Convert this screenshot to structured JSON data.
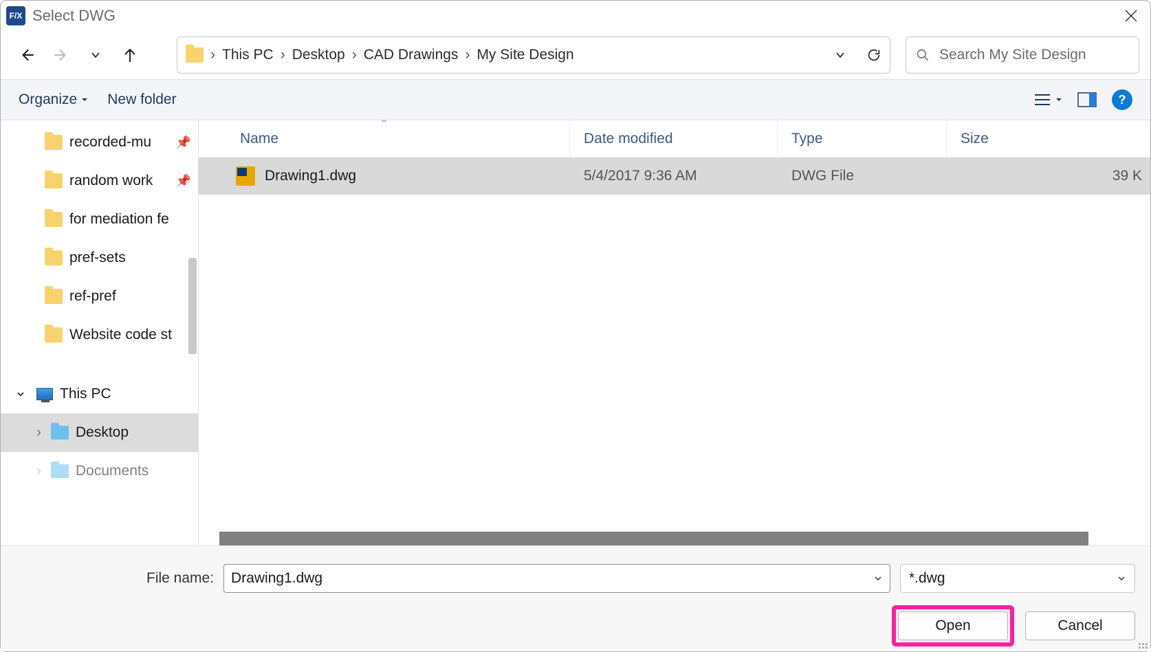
{
  "title": "Select DWG",
  "breadcrumbs": [
    "This PC",
    "Desktop",
    "CAD Drawings",
    "My Site Design"
  ],
  "search": {
    "placeholder": "Search My Site Design"
  },
  "toolbar": {
    "organize": "Organize",
    "newfolder": "New folder"
  },
  "sidebar": [
    {
      "label": "recorded-mu",
      "pinned": true
    },
    {
      "label": "random work",
      "pinned": true
    },
    {
      "label": "for mediation fe",
      "pinned": false
    },
    {
      "label": "pref-sets",
      "pinned": false
    },
    {
      "label": "ref-pref",
      "pinned": false
    },
    {
      "label": "Website code st",
      "pinned": false
    }
  ],
  "thispc": {
    "label": "This PC"
  },
  "desktop": {
    "label": "Desktop"
  },
  "documents": {
    "label": "Documents"
  },
  "columns": {
    "name": "Name",
    "date": "Date modified",
    "type": "Type",
    "size": "Size"
  },
  "files": [
    {
      "name": "Drawing1.dwg",
      "date": "5/4/2017 9:36 AM",
      "type": "DWG File",
      "size": "39 K"
    }
  ],
  "footer": {
    "filename_label": "File name:",
    "filename_value": "Drawing1.dwg",
    "filter": "*.dwg",
    "open": "Open",
    "cancel": "Cancel"
  }
}
